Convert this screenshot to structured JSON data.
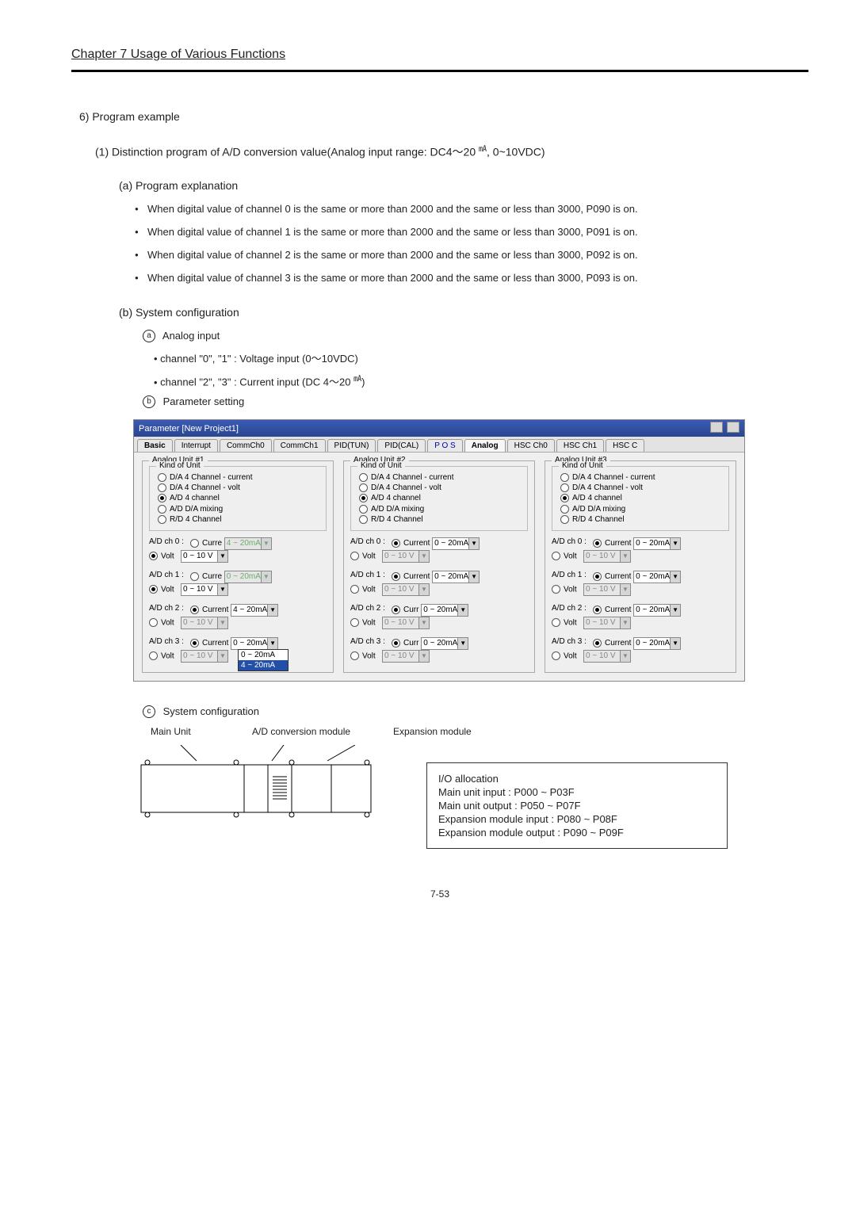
{
  "chapter": "Chapter 7    Usage of Various Functions",
  "sec6": "6) Program example",
  "sec1_pre": "(1)   Distinction program of A/D conversion value(Analog input range: DC4～20 ",
  "sec1_unit": "㎃",
  "sec1_post": ", 0~10VDC)",
  "secA_a": "(a) Program explanation",
  "bulletsA": [
    "When digital value of channel 0 is the same or more than 2000 and the same or less than 3000, P090 is on.",
    "When digital value of channel 1 is the same or more than 2000 and the same or less than 3000, P091 is on.",
    "When digital value of channel 2 is the same or more than 2000 and the same or less than 3000, P092 is on.",
    "When digital value of channel 3 is the same or more than 2000 and the same or less than 3000, P093 is on."
  ],
  "secA_b": "(b) System configuration",
  "circA": "Analog input",
  "circA_sub1_pre": "channel \"0\", \"1\" : Voltage input (0～10VDC)",
  "circA_sub2_pre": "channel \"2\", \"3\" : Current input (DC 4～20 ",
  "circA_sub2_unit": "㎃",
  "circA_sub2_post": ")",
  "circB": "Parameter setting",
  "paramTitle": "Parameter [New Project1]",
  "tabs": [
    "Basic",
    "Interrupt",
    "CommCh0",
    "CommCh1",
    "PID(TUN)",
    "PID(CAL)",
    "P O S",
    "Analog",
    "HSC Ch0",
    "HSC Ch1",
    "HSC C"
  ],
  "tabSelected": 7,
  "tabBold": 0,
  "kindLabel": "Kind of Unit",
  "kindOptions": [
    "D/A 4 Channel - current",
    "D/A 4 Channel - volt",
    "A/D 4 channel",
    "A/D D/A mixing",
    "R/D 4 Channel"
  ],
  "kindSel": 2,
  "volt_range": "0 ~ 10 V",
  "volt_dis": "0 ~ 10 V",
  "currLabel_full": "Current",
  "currLabel_cut": "Curre",
  "currLabel_curr": "Curr",
  "voltLabel": "Volt",
  "units": [
    {
      "label": "Analog Unit #1",
      "ch": [
        {
          "name": "A/D ch 0 :",
          "sel": "volt",
          "curLbl": "Curre",
          "curRange": "4 ~ 20mA",
          "curDis": true,
          "curDisGreen": true,
          "voltRange": "0 ~ 10 V",
          "voltDis": false
        },
        {
          "name": "A/D ch 1 :",
          "sel": "volt",
          "curLbl": "Curre",
          "curRange": "0 ~ 20mA",
          "curDis": true,
          "curDisGreen": true,
          "voltRange": "0 ~ 10 V",
          "voltDis": false
        },
        {
          "name": "A/D ch 2 :",
          "sel": "curr",
          "curLbl": "Current",
          "curRange": "4 ~ 20mA",
          "curDis": false,
          "voltRange": "0 ~ 10 V",
          "voltDis": true
        },
        {
          "name": "A/D ch 3 :",
          "sel": "curr",
          "curLbl": "Current",
          "curRange": "0 ~ 20mA",
          "curDis": false,
          "voltRange": "",
          "voltDis": true,
          "open": true
        }
      ]
    },
    {
      "label": "Analog Unit #2",
      "ch": [
        {
          "name": "A/D ch 0 :",
          "sel": "curr",
          "curLbl": "Current",
          "curRange": "0 ~ 20mA",
          "curDis": false,
          "voltRange": "0 ~ 10 V",
          "voltDis": true
        },
        {
          "name": "A/D ch 1 :",
          "sel": "curr",
          "curLbl": "Current",
          "curRange": "0 ~ 20mA",
          "curDis": false,
          "voltRange": "0 ~ 10 V",
          "voltDis": true
        },
        {
          "name": "A/D ch 2 :",
          "sel": "curr",
          "curLbl": "Curr",
          "curRange": "0 ~ 20mA",
          "curDis": false,
          "voltRange": "0 ~ 10 V",
          "voltDis": true
        },
        {
          "name": "A/D ch 3 :",
          "sel": "curr",
          "curLbl": "Curr",
          "curRange": "0 ~ 20mA",
          "curDis": false,
          "voltRange": "0 ~ 10 V",
          "voltDis": true
        }
      ]
    },
    {
      "label": "Analog Unit #3",
      "ch": [
        {
          "name": "A/D ch 0 :",
          "sel": "curr",
          "curLbl": "Current",
          "curRange": "0 ~ 20mA",
          "curDis": false,
          "voltRange": "0 ~ 10 V",
          "voltDis": true
        },
        {
          "name": "A/D ch 1 :",
          "sel": "curr",
          "curLbl": "Current",
          "curRange": "0 ~ 20mA",
          "curDis": false,
          "voltRange": "0 ~ 10 V",
          "voltDis": true
        },
        {
          "name": "A/D ch 2 :",
          "sel": "curr",
          "curLbl": "Current",
          "curRange": "0 ~ 20mA",
          "curDis": false,
          "voltRange": "0 ~ 10 V",
          "voltDis": true
        },
        {
          "name": "A/D ch 3 :",
          "sel": "curr",
          "curLbl": "Current",
          "curRange": "0 ~ 20mA",
          "curDis": false,
          "voltRange": "0 ~ 10 V",
          "voltDis": true
        }
      ]
    }
  ],
  "ddOpen": {
    "items": [
      "0 ~ 20mA",
      "4 ~ 20mA"
    ],
    "hl": 1
  },
  "circC": "System configuration",
  "hwLabels": [
    "Main Unit",
    "A/D conversion module",
    "Expansion module"
  ],
  "ioTitle": "I/O allocation",
  "ioLines": [
    "Main unit input : P000 ~ P03F",
    "Main unit output : P050 ~ P07F",
    "Expansion module input : P080 ~ P08F",
    "Expansion module output : P090 ~ P09F"
  ],
  "footer": "7-53"
}
